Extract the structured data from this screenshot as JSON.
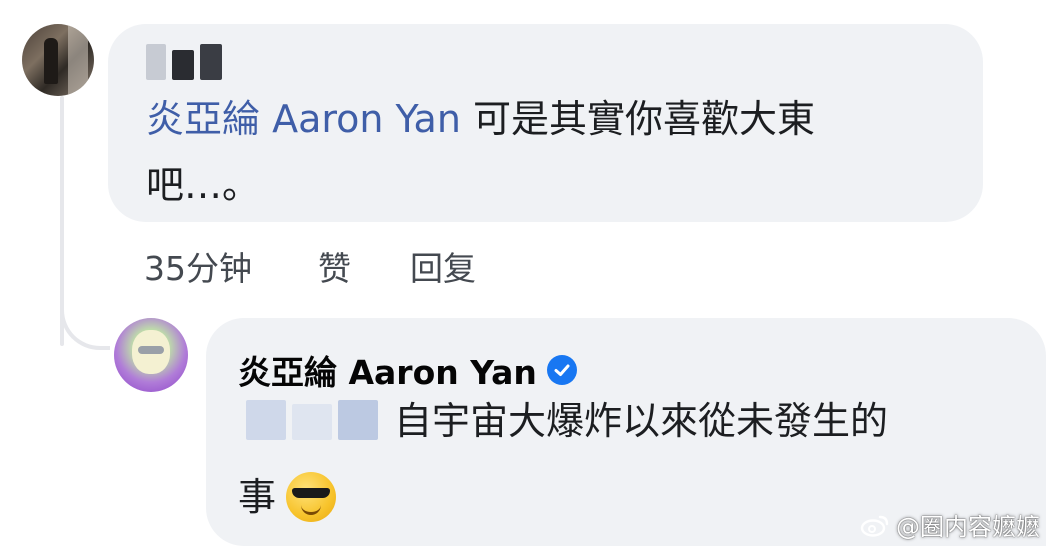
{
  "comment": {
    "mention": "炎亞綸 Aaron Yan",
    "text_line1": "可是其實你喜歡大東",
    "text_line2": "吧…。",
    "time": "35分钟",
    "like": "赞",
    "reply": "回复"
  },
  "reply": {
    "author": "炎亞綸 Aaron Yan",
    "text_line1": "自宇宙大爆炸以來從未發生的",
    "text_line2": "事"
  },
  "icons": {
    "verified": "verified-badge-icon",
    "emoji": "smiling-face-with-sunglasses-icon",
    "weibo": "weibo-logo-icon"
  },
  "watermark": {
    "text": "@圈内容嬷嬷"
  },
  "colors": {
    "mention": "#3f5ea8",
    "bubble": "#f0f2f5",
    "verified": "#1877f2"
  }
}
